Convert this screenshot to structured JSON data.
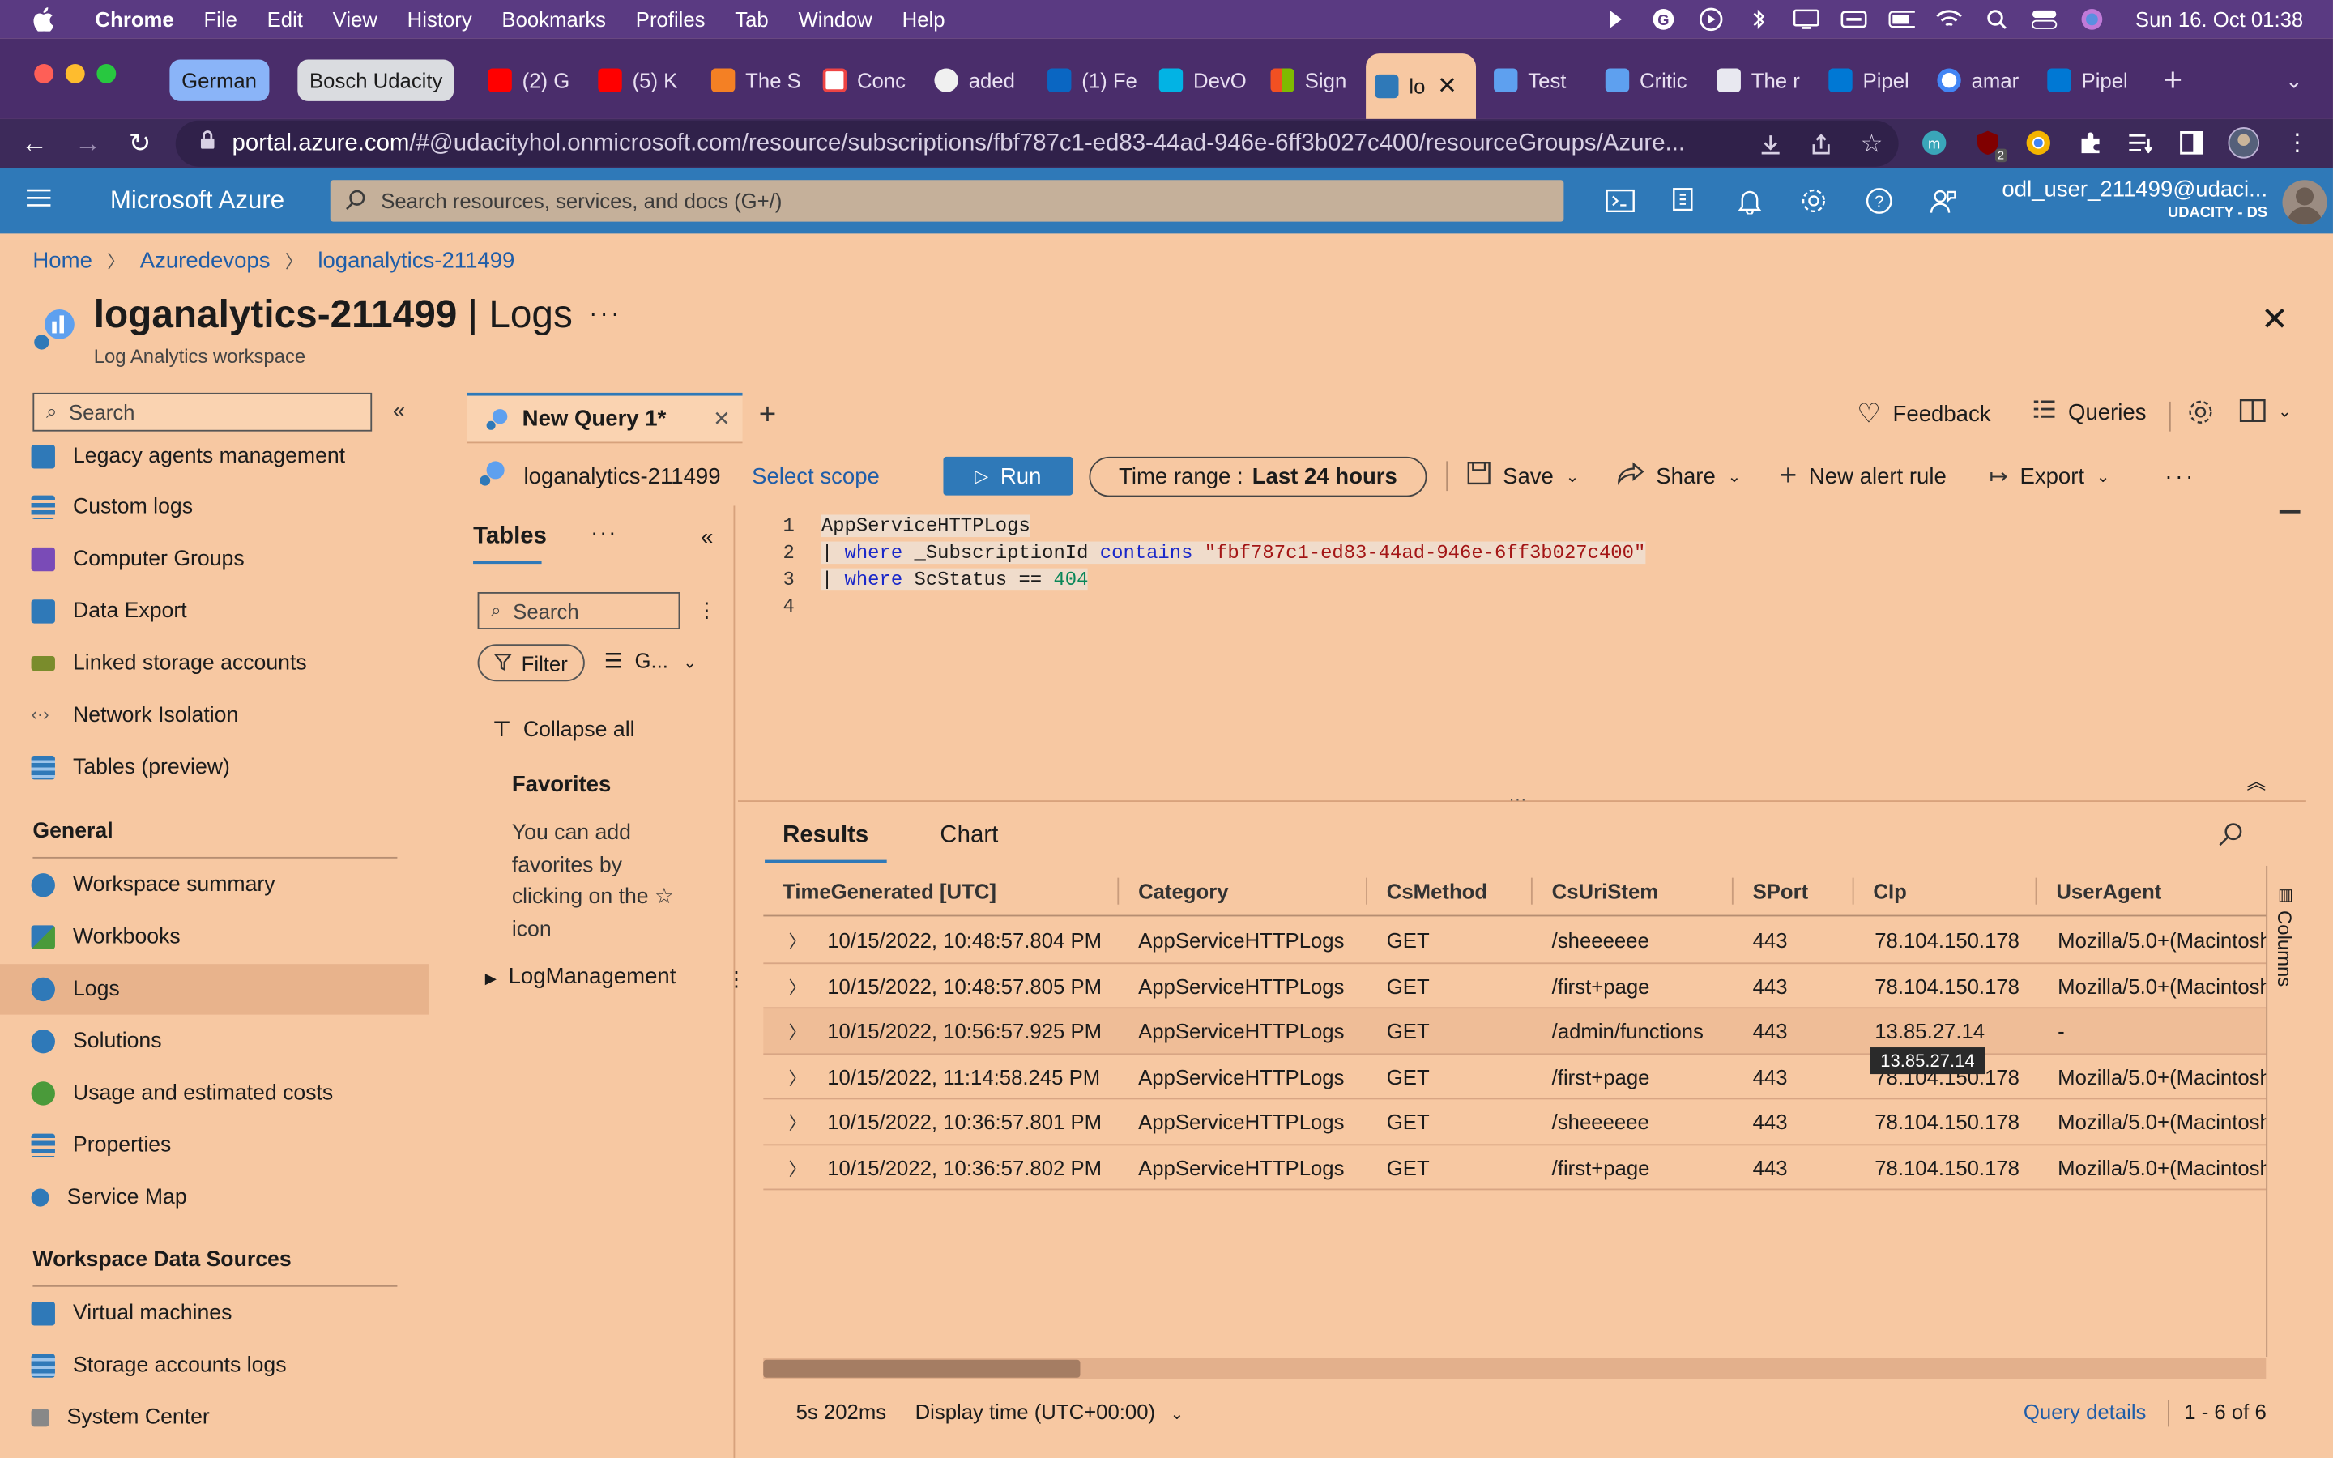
{
  "menubar": {
    "app": "Chrome",
    "items": [
      "File",
      "Edit",
      "View",
      "History",
      "Bookmarks",
      "Profiles",
      "Tab",
      "Window",
      "Help"
    ],
    "datetime": "Sun 16. Oct  01:38"
  },
  "browser_tabs": [
    {
      "label": "German",
      "kind": "group",
      "color": "#8ab4f8"
    },
    {
      "label": "Bosch Udacity",
      "kind": "group",
      "color": "#dadce0"
    },
    {
      "label": "(2) G",
      "icon": "youtube-icon"
    },
    {
      "label": "(5) K",
      "icon": "youtube-icon"
    },
    {
      "label": "The S",
      "icon": "stackoverflow-icon"
    },
    {
      "label": "Conc",
      "icon": "concourse-icon"
    },
    {
      "label": "aded",
      "icon": "github-icon"
    },
    {
      "label": "(1) Fe",
      "icon": "linkedin-icon"
    },
    {
      "label": "DevO",
      "icon": "udacity-icon"
    },
    {
      "label": "Sign",
      "icon": "microsoft-icon"
    },
    {
      "label": "lo",
      "icon": "azure-icon",
      "active": true
    },
    {
      "label": "Test",
      "icon": "azure-icon"
    },
    {
      "label": "Critic",
      "icon": "azure-icon"
    },
    {
      "label": "The r",
      "icon": "doc-icon"
    },
    {
      "label": "Pipel",
      "icon": "devops-icon"
    },
    {
      "label": "amar",
      "icon": "google-icon"
    },
    {
      "label": "Pipel",
      "icon": "devops-icon"
    }
  ],
  "address": {
    "host": "portal.azure.com",
    "path": "/#@udacityhol.onmicrosoft.com/resource/subscriptions/fbf787c1-ed83-44ad-946e-6ff3b027c400/resourceGroups/Azure..."
  },
  "extensions": {
    "badge": "2"
  },
  "azure": {
    "brand": "Microsoft Azure",
    "search_placeholder": "Search resources, services, and docs (G+/)",
    "user_name": "odl_user_211499@udaci...",
    "user_tenant": "UDACITY - DS"
  },
  "breadcrumb": [
    "Home",
    "Azuredevops",
    "loganalytics-211499"
  ],
  "page": {
    "title": "loganalytics-211499",
    "title_suffix": "| Logs",
    "subtitle": "Log Analytics workspace",
    "more": "···"
  },
  "leftnav": {
    "search_placeholder": "Search",
    "items_top": [
      {
        "label": "Legacy agents management",
        "color": "#2f79b8"
      },
      {
        "label": "Custom logs",
        "color": "#2f79b8"
      },
      {
        "label": "Computer Groups",
        "color": "#7a4bb7"
      },
      {
        "label": "Data Export",
        "color": "#2f79b8"
      },
      {
        "label": "Linked storage accounts",
        "color": "#7a8c2c"
      },
      {
        "label": "Network Isolation",
        "color": "#555555"
      },
      {
        "label": "Tables (preview)",
        "color": "#2f79b8"
      }
    ],
    "section_general": "General",
    "items_general": [
      {
        "label": "Workspace summary",
        "color": "#2f79b8"
      },
      {
        "label": "Workbooks",
        "color": "#2f79b8"
      },
      {
        "label": "Logs",
        "color": "#2f79b8",
        "selected": true
      },
      {
        "label": "Solutions",
        "color": "#2f79b8"
      },
      {
        "label": "Usage and estimated costs",
        "color": "#4a9a3a"
      },
      {
        "label": "Properties",
        "color": "#2f79b8"
      },
      {
        "label": "Service Map",
        "color": "#2f79b8"
      }
    ],
    "section_sources": "Workspace Data Sources",
    "items_sources": [
      {
        "label": "Virtual machines",
        "color": "#2f79b8"
      },
      {
        "label": "Storage accounts logs",
        "color": "#2f79b8"
      },
      {
        "label": "System Center",
        "color": "#555555"
      }
    ]
  },
  "query": {
    "tab_label": "New Query 1*",
    "scope": "loganalytics-211499",
    "select_scope": "Select scope",
    "run": "Run",
    "time_range_label": "Time range :",
    "time_range_value": "Last 24 hours",
    "save": "Save",
    "share": "Share",
    "new_alert": "New alert rule",
    "export": "Export",
    "feedback": "Feedback",
    "queries": "Queries",
    "line1": "AppServiceHTTPLogs",
    "line2_pipe": "| ",
    "line2_kw": "where",
    "line2_field": " _SubscriptionId ",
    "line2_op": "contains",
    "line2_str": "\"fbf787c1-ed83-44ad-946e-6ff3b027c400\"",
    "line3_pipe": "| ",
    "line3_kw": "where",
    "line3_field": " ScStatus == ",
    "line3_num": "404",
    "line_numbers": [
      "1",
      "2",
      "3",
      "4"
    ]
  },
  "tables_pane": {
    "title": "Tables",
    "search_placeholder": "Search",
    "filter": "Filter",
    "group_by": "G...",
    "collapse_all": "Collapse all",
    "favorites_title": "Favorites",
    "favorites_text": "You can add favorites by clicking on the ☆ icon",
    "log_management": "LogManagement"
  },
  "results": {
    "tab_results": "Results",
    "tab_chart": "Chart",
    "columns": [
      "TimeGenerated [UTC]",
      "Category",
      "CsMethod",
      "CsUriStem",
      "SPort",
      "CIp",
      "UserAgent"
    ],
    "rows": [
      [
        "10/15/2022, 10:48:57.804 PM",
        "AppServiceHTTPLogs",
        "GET",
        "/sheeeeee",
        "443",
        "78.104.150.178",
        "Mozilla/5.0+(Macintosh"
      ],
      [
        "10/15/2022, 10:48:57.805 PM",
        "AppServiceHTTPLogs",
        "GET",
        "/first+page",
        "443",
        "78.104.150.178",
        "Mozilla/5.0+(Macintosh"
      ],
      [
        "10/15/2022, 10:56:57.925 PM",
        "AppServiceHTTPLogs",
        "GET",
        "/admin/functions",
        "443",
        "13.85.27.14",
        "-"
      ],
      [
        "10/15/2022, 11:14:58.245 PM",
        "AppServiceHTTPLogs",
        "GET",
        "/first+page",
        "443",
        "78.104.150.178",
        "Mozilla/5.0+(Macintosh"
      ],
      [
        "10/15/2022, 10:36:57.801 PM",
        "AppServiceHTTPLogs",
        "GET",
        "/sheeeeee",
        "443",
        "78.104.150.178",
        "Mozilla/5.0+(Macintosh"
      ],
      [
        "10/15/2022, 10:36:57.802 PM",
        "AppServiceHTTPLogs",
        "GET",
        "/first+page",
        "443",
        "78.104.150.178",
        "Mozilla/5.0+(Macintosh"
      ]
    ],
    "tooltip": "13.85.27.14",
    "columns_rail": "Columns",
    "duration": "5s 202ms",
    "display_time": "Display time (UTC+00:00)",
    "query_details": "Query details",
    "count": "1 - 6 of 6"
  }
}
